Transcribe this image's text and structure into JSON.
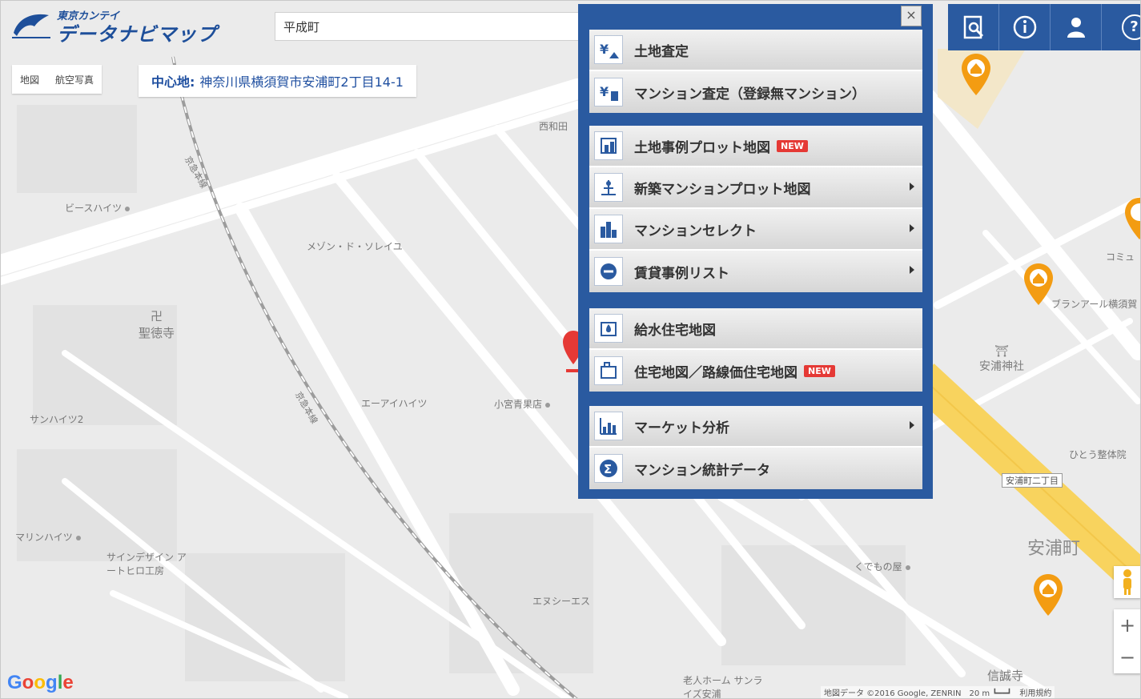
{
  "app": {
    "brand_sub": "東京カンテイ",
    "brand_main": "データナビマップ"
  },
  "search": {
    "value": "平成町"
  },
  "map_type": {
    "map": "地図",
    "aerial": "航空写真"
  },
  "center": {
    "label": "中心地:",
    "address": "神奈川県横須賀市安浦町2丁目14-1"
  },
  "toolbar": {
    "buttons": [
      "report-icon",
      "info-icon",
      "user-icon",
      "help-icon"
    ],
    "help_glyph": "?"
  },
  "menu": {
    "close_glyph": "×",
    "groups": [
      {
        "items": [
          {
            "label": "土地査定",
            "icon": "land-appraisal-icon"
          },
          {
            "label": "マンション査定（登録無マンション）",
            "icon": "condo-appraisal-icon"
          }
        ]
      },
      {
        "items": [
          {
            "label": "土地事例プロット地図",
            "icon": "land-plot-map-icon",
            "badge": "NEW"
          },
          {
            "label": "新築マンションプロット地図",
            "icon": "new-condo-plot-icon",
            "submenu": true
          },
          {
            "label": "マンションセレクト",
            "icon": "condo-select-icon",
            "submenu": true
          },
          {
            "label": "賃貸事例リスト",
            "icon": "rental-list-icon",
            "submenu": true
          }
        ]
      },
      {
        "items": [
          {
            "label": "給水住宅地図",
            "icon": "water-map-icon"
          },
          {
            "label": "住宅地図／路線価住宅地図",
            "icon": "housing-map-icon",
            "badge": "NEW"
          }
        ]
      },
      {
        "items": [
          {
            "label": "マーケット分析",
            "icon": "market-analysis-icon",
            "submenu": true
          },
          {
            "label": "マンション統計データ",
            "icon": "condo-stats-icon"
          }
        ]
      }
    ]
  },
  "map": {
    "railway": "京急本線",
    "temple": "聖徳寺",
    "temple_glyph": "卍",
    "shrine": "安浦神社",
    "shrine_glyph": "⛩",
    "area": "安浦町",
    "signal": "安浦町二丁目",
    "pois": [
      "ビースハイツ",
      "メゾン・ド・ソレイユ",
      "エーアイハイツ",
      "小宮青果店",
      "サンハイツ2",
      "マリンハイツ",
      "サインデザイン アートヒロ工房",
      "エヌシーエス",
      "くでもの屋",
      "ひとう整体院",
      "ブランアール横須賀",
      "コミュ",
      "信誠寺",
      "老人ホーム サンライズ安浦",
      "西和田"
    ]
  },
  "attribution": {
    "google": "Google",
    "copyright": "地図データ ©2016 Google, ZENRIN　20 m ┗━━┛　利用規約"
  },
  "colors": {
    "brand": "#2a5aa0",
    "new_badge": "#e53935",
    "pin_orange": "#f39c12",
    "road_yellow": "#f8d35e"
  }
}
